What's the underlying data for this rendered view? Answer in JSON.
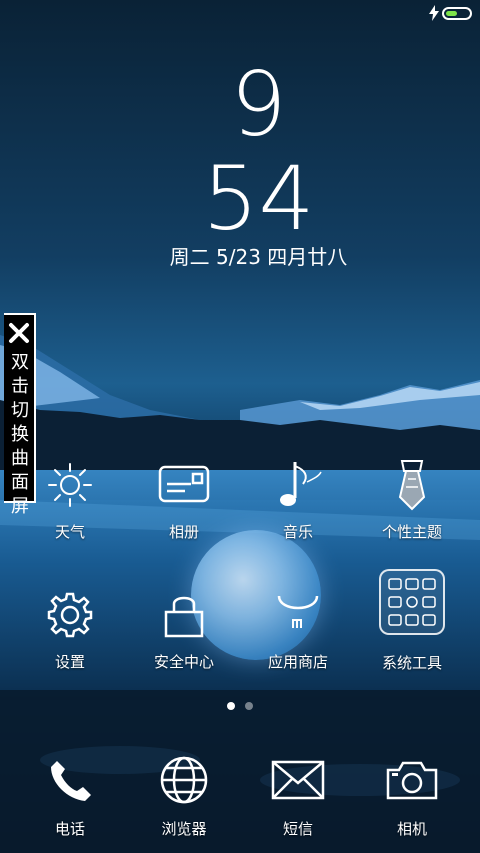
{
  "status_bar": {
    "charging_icon": "lightning-bolt-icon",
    "battery_icon": "battery-icon",
    "battery_level": 0.5,
    "battery_color": "#7ee34a"
  },
  "clock": {
    "hour": "9",
    "minute": "54",
    "date": "周二 5/23 四月廿八"
  },
  "side_panel": {
    "close_icon": "close-icon",
    "label": "双击切换曲面屏"
  },
  "apps": [
    {
      "label": "天气",
      "icon": "sun-icon"
    },
    {
      "label": "相册",
      "icon": "photo-album-icon"
    },
    {
      "label": "音乐",
      "icon": "music-note-icon"
    },
    {
      "label": "个性主题",
      "icon": "necktie-icon"
    },
    {
      "label": "设置",
      "icon": "gear-icon"
    },
    {
      "label": "安全中心",
      "icon": "lock-icon"
    },
    {
      "label": "应用商店",
      "icon": "app-store-icon"
    },
    {
      "label": "系统工具",
      "icon": "system-tools-folder-icon"
    }
  ],
  "pager": {
    "pages": 2,
    "current": 1
  },
  "dock": [
    {
      "label": "电话",
      "icon": "phone-icon"
    },
    {
      "label": "浏览器",
      "icon": "globe-icon"
    },
    {
      "label": "短信",
      "icon": "envelope-icon"
    },
    {
      "label": "相机",
      "icon": "camera-icon"
    }
  ]
}
